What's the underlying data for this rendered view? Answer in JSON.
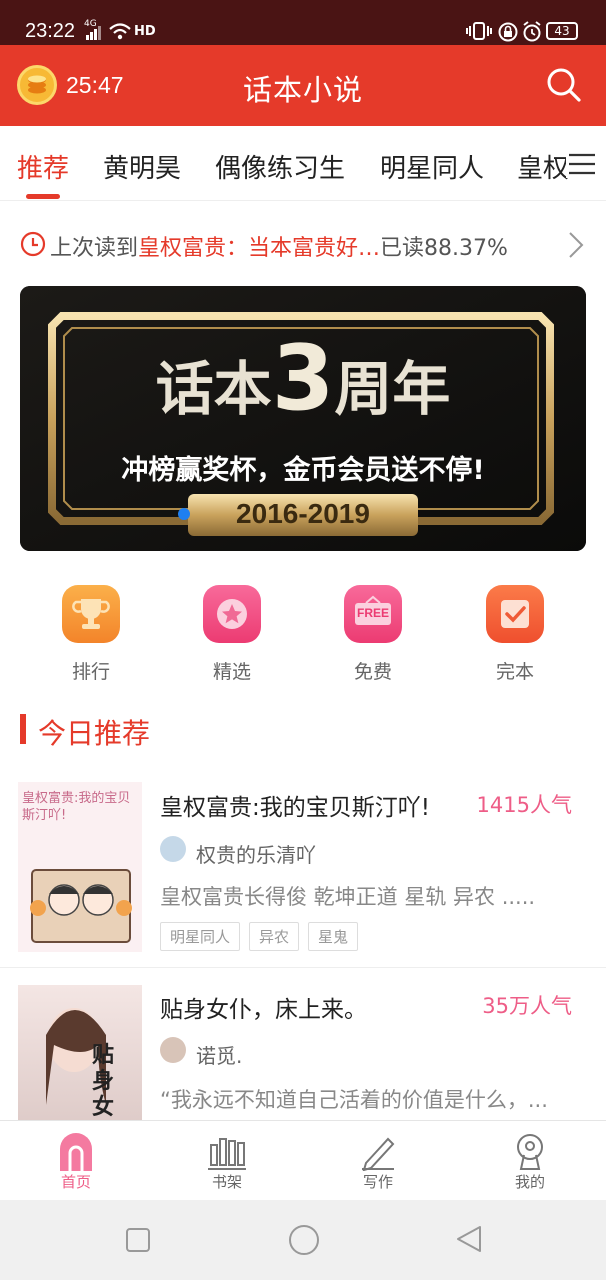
{
  "status_bar": {
    "time": "23:22",
    "network": "4G",
    "battery": "43"
  },
  "app_bar": {
    "timer": "25:47",
    "title": "话本小说"
  },
  "tabs": [
    {
      "label": "推荐",
      "active": true
    },
    {
      "label": "黄明昊",
      "active": false
    },
    {
      "label": "偶像练习生",
      "active": false
    },
    {
      "label": "明星同人",
      "active": false
    },
    {
      "label": "皇权",
      "active": false
    }
  ],
  "last_read": {
    "prefix": "上次读到",
    "book": "皇权富贵：当本富贵好…",
    "progress": "已读88.37%"
  },
  "banner": {
    "title_left": "话本",
    "title_num": "3",
    "title_right": "周年",
    "subtitle": "冲榜赢奖杯，金币会员送不停!",
    "years": "2016-2019"
  },
  "quick_links": [
    {
      "label": "排行",
      "icon": "trophy-icon",
      "color": "#f89a2c"
    },
    {
      "label": "精选",
      "icon": "star-icon",
      "color": "#f04f85"
    },
    {
      "label": "免费",
      "icon": "free-tag-icon",
      "color": "#f04f85",
      "badge": "FREE"
    },
    {
      "label": "完本",
      "icon": "check-icon",
      "color": "#f0663a"
    }
  ],
  "section": {
    "title": "今日推荐"
  },
  "books": [
    {
      "title": "皇权富贵:我的宝贝斯汀吖!",
      "popularity": "1415人气",
      "author": "权贵的乐清吖",
      "desc": "皇权富贵长得俊 乾坤正道 星轨 异农 .....",
      "tags": [
        "明星同人",
        "异农",
        "星鬼"
      ],
      "cover_text": "皇权富贵:我的宝贝斯汀吖!"
    },
    {
      "title": "贴身女仆，床上来。",
      "popularity": "35万人气",
      "author": "诺觅.",
      "desc": "“我永远不知道自己活着的价值是什么，...",
      "tags": [],
      "cover_text": "贴身女仆"
    }
  ],
  "bottom_nav": [
    {
      "label": "首页",
      "active": true
    },
    {
      "label": "书架",
      "active": false
    },
    {
      "label": "写作",
      "active": false
    },
    {
      "label": "我的",
      "active": false
    }
  ],
  "colors": {
    "brand_red": "#e53a2a",
    "pink": "#ee5d87",
    "status_bar": "#4a1414"
  }
}
